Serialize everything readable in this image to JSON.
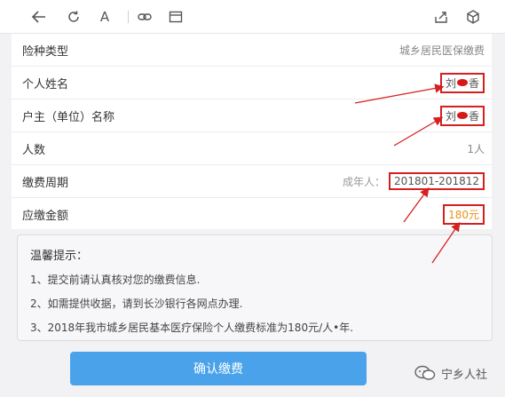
{
  "toolbar": {
    "icons": [
      "back-arrow-icon",
      "refresh-icon",
      "font-icon",
      "link-icon",
      "window-icon",
      "share-icon",
      "cube-icon"
    ],
    "font_glyph": "A"
  },
  "form": {
    "rows": [
      {
        "label": "险种类型",
        "value": "城乡居民医保缴费"
      },
      {
        "label": "个人姓名",
        "value_a": "刘",
        "value_b": "香"
      },
      {
        "label": "户主（单位）名称",
        "value_a": "刘",
        "value_b": "香"
      },
      {
        "label": "人数",
        "value": "1人"
      },
      {
        "label": "缴费周期",
        "prefix": "成年人：",
        "value": "201801-201812"
      },
      {
        "label": "应缴金额",
        "value": "180元"
      }
    ]
  },
  "notice": {
    "title": "温馨提示：",
    "lines": [
      "1、提交前请认真核对您的缴费信息.",
      "2、如需提供收据，请到长沙银行各网点办理.",
      "3、2018年我市城乡居民基本医疗保险个人缴费标准为180元/人•年."
    ]
  },
  "confirm_label": "确认缴费",
  "watermark": {
    "text": "宁乡人社"
  },
  "colors": {
    "accent": "#4aa3ea",
    "highlight": "#d62020",
    "amount": "#e8931e"
  }
}
